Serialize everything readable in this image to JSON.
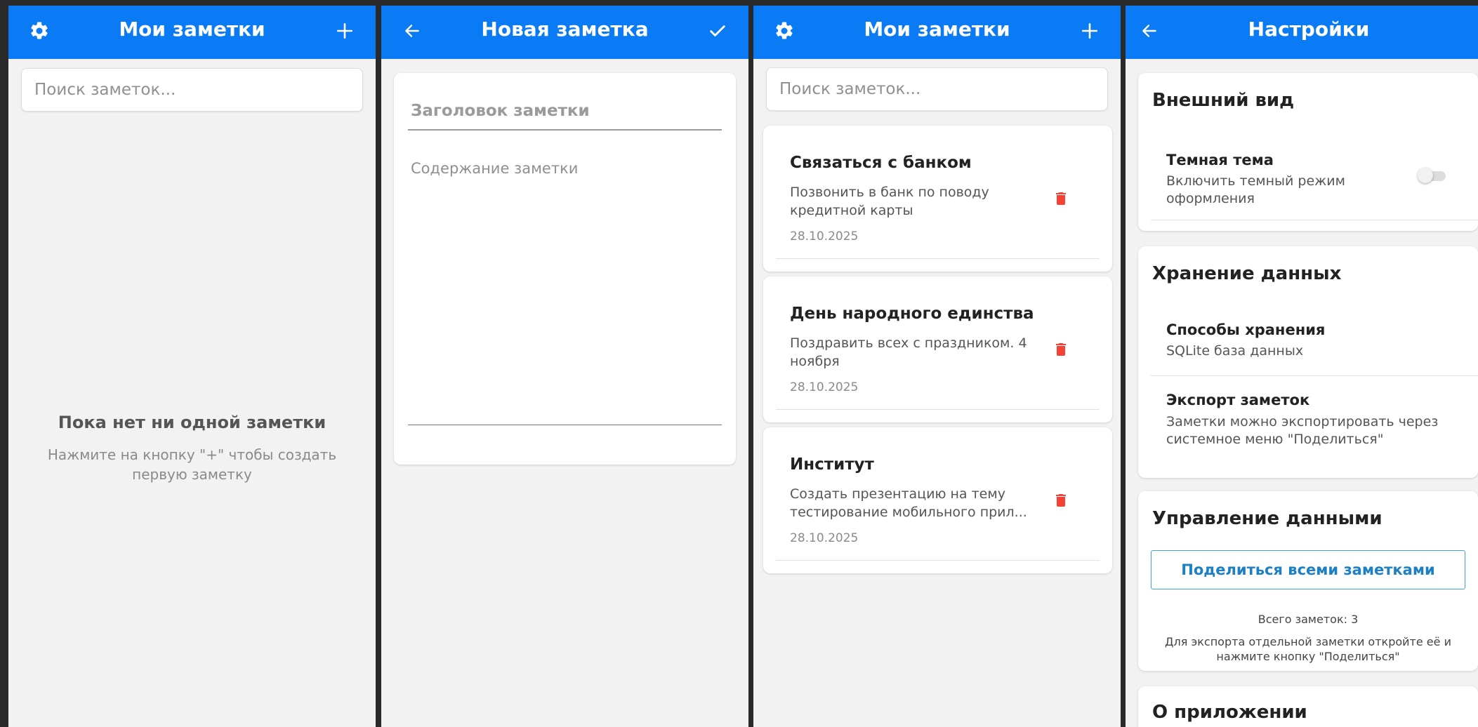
{
  "colors": {
    "accent": "#0a7bf5",
    "danger": "#f44336",
    "background": "#f2f2f2"
  },
  "screen_list": {
    "title": "Мои заметки",
    "settings_icon": "gear-icon",
    "add_icon": "plus-icon",
    "search_placeholder": "Поиск заметок...",
    "empty_title": "Пока нет ни одной заметки",
    "empty_hint": "Нажмите на кнопку \"+\" чтобы создать первую заметку"
  },
  "screen_new": {
    "title": "Новая заметка",
    "back_icon": "arrow-left-icon",
    "save_icon": "check-icon",
    "title_placeholder": "Заголовок заметки",
    "content_placeholder": "Содержание заметки"
  },
  "screen_notes": {
    "title": "Мои заметки",
    "search_placeholder": "Поиск заметок...",
    "notes": [
      {
        "title": "Связаться с банком",
        "body": "Позвонить в банк по поводу кредитной карты",
        "date": "28.10.2025"
      },
      {
        "title": "День народного единства",
        "body": "Поздравить всех с праздником. 4 ноября",
        "date": "28.10.2025"
      },
      {
        "title": "Институт",
        "body": "Создать презентацию на тему тестирование мобильного прил...",
        "date": "28.10.2025"
      }
    ]
  },
  "screen_settings": {
    "title": "Настройки",
    "appearance": {
      "heading": "Внешний вид",
      "dark_theme_title": "Темная тема",
      "dark_theme_sub": "Включить темный режим оформления",
      "dark_theme_enabled": false
    },
    "storage": {
      "heading": "Хранение данных",
      "method_title": "Способы хранения",
      "method_sub": "SQLite база данных",
      "export_title": "Экспорт заметок",
      "export_sub": "Заметки можно экспортировать через системное меню \"Поделиться\""
    },
    "data": {
      "heading": "Управление данными",
      "share_button": "Поделиться всеми заметками",
      "total": "Всего заметок: 3",
      "hint": "Для экспорта отдельной заметки откройте её и нажмите кнопку \"Поделиться\""
    },
    "about": {
      "heading": "О приложении"
    }
  }
}
